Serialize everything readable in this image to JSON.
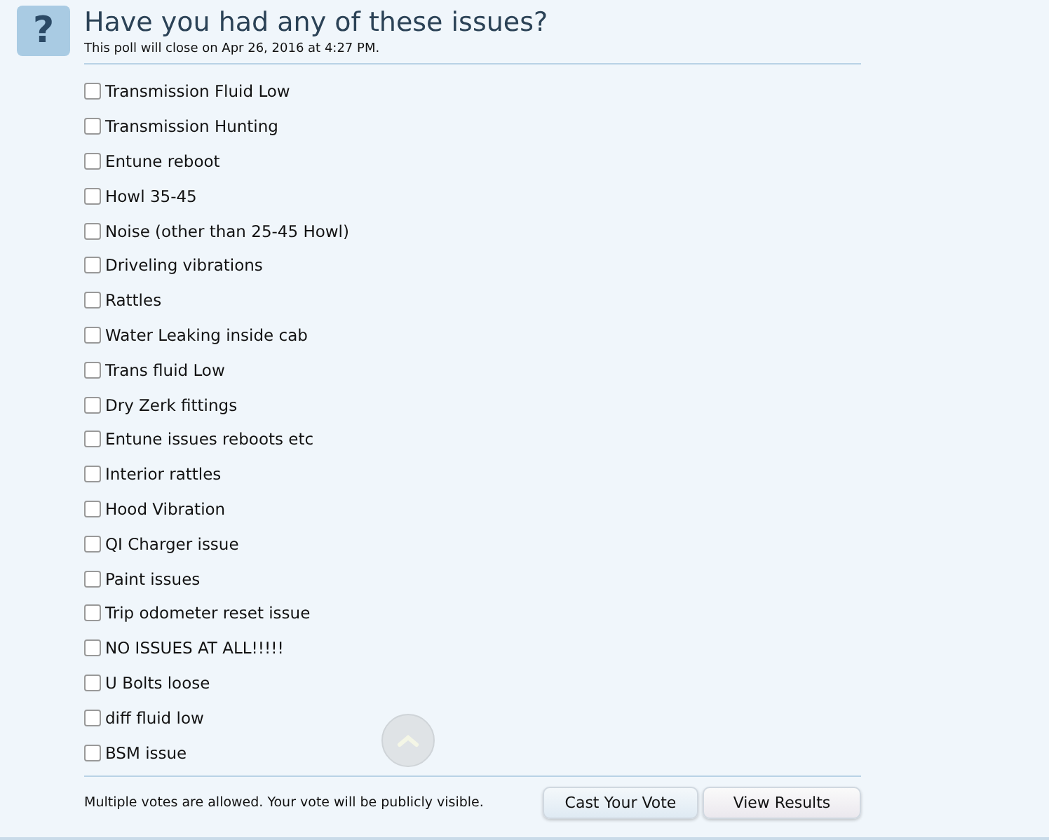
{
  "poll": {
    "icon": "?",
    "question": "Have you had any of these issues?",
    "close_note": "This poll will close on Apr 26, 2016 at 4:27 PM.",
    "options": [
      {
        "label": "Transmission Fluid Low",
        "checked": false
      },
      {
        "label": "Transmission Hunting",
        "checked": false
      },
      {
        "label": "Entune reboot",
        "checked": false
      },
      {
        "label": "Howl 35-45",
        "checked": false
      },
      {
        "label": "Noise (other than 25-45 Howl)",
        "checked": false
      },
      {
        "label": "Driveling vibrations",
        "checked": false
      },
      {
        "label": "Rattles",
        "checked": false
      },
      {
        "label": "Water Leaking inside cab",
        "checked": false
      },
      {
        "label": "Trans fluid Low",
        "checked": false
      },
      {
        "label": "Dry Zerk fittings",
        "checked": false
      },
      {
        "label": "Entune issues reboots etc",
        "checked": false
      },
      {
        "label": "Interior rattles",
        "checked": false
      },
      {
        "label": "Hood Vibration",
        "checked": false
      },
      {
        "label": "QI Charger issue",
        "checked": false
      },
      {
        "label": "Paint issues",
        "checked": false
      },
      {
        "label": "Trip odometer reset issue",
        "checked": false
      },
      {
        "label": "NO ISSUES AT ALL!!!!!",
        "checked": false
      },
      {
        "label": "U Bolts loose",
        "checked": false
      },
      {
        "label": "diff fluid low",
        "checked": false
      },
      {
        "label": "BSM issue",
        "checked": false
      }
    ],
    "footer_note": "Multiple votes are allowed. Your vote will be publicly visible.",
    "buttons": [
      {
        "label": "Cast Your Vote",
        "kind": "primary"
      },
      {
        "label": "View Results",
        "kind": "secondary"
      }
    ]
  }
}
